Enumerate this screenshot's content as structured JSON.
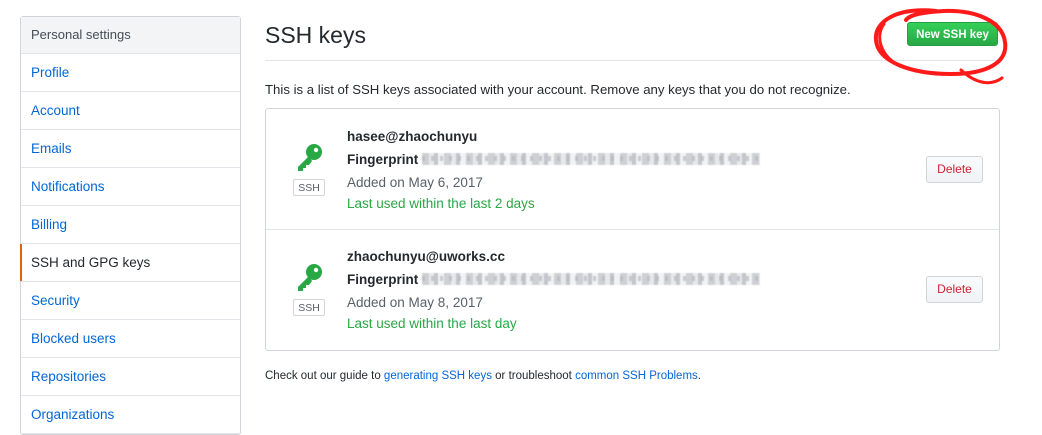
{
  "sidebar": {
    "header": "Personal settings",
    "items": [
      {
        "label": "Profile"
      },
      {
        "label": "Account"
      },
      {
        "label": "Emails"
      },
      {
        "label": "Notifications"
      },
      {
        "label": "Billing"
      },
      {
        "label": "SSH and GPG keys",
        "selected": true
      },
      {
        "label": "Security"
      },
      {
        "label": "Blocked users"
      },
      {
        "label": "Repositories"
      },
      {
        "label": "Organizations"
      }
    ]
  },
  "main": {
    "title": "SSH keys",
    "new_button": "New SSH key",
    "intro": "This is a list of SSH keys associated with your account. Remove any keys that you do not recognize.",
    "keys": [
      {
        "title": "hasee@zhaochunyu",
        "fingerprint_label": "Fingerprint",
        "tag": "SSH",
        "added": "Added on May 6, 2017",
        "last_used": "Last used within the last 2 days",
        "delete": "Delete"
      },
      {
        "title": "zhaochunyu@uworks.cc",
        "fingerprint_label": "Fingerprint",
        "tag": "SSH",
        "added": "Added on May 8, 2017",
        "last_used": "Last used within the last day",
        "delete": "Delete"
      }
    ],
    "footer": {
      "pre": "Check out our guide to ",
      "link1": "generating SSH keys",
      "mid": " or troubleshoot ",
      "link2": "common SSH Problems",
      "post": "."
    }
  },
  "colors": {
    "link": "#0366d6",
    "primary_button": "#28a745",
    "danger": "#cb2431",
    "selected_accent": "#e36209",
    "annotation": "#ff0000"
  }
}
